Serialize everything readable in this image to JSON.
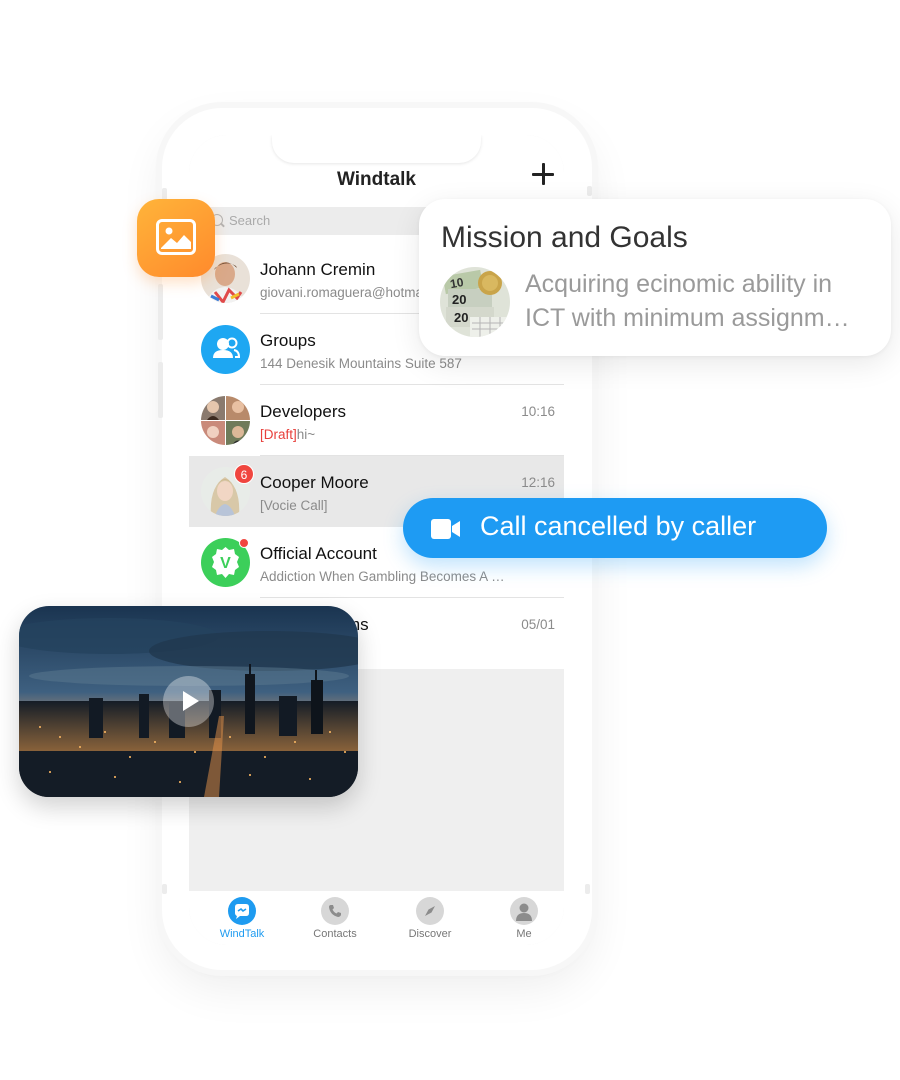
{
  "app": {
    "title": "Windtalk"
  },
  "search": {
    "placeholder": "Search"
  },
  "chats": [
    {
      "name": "Johann Cremin",
      "subtitle": "giovani.romaguera@hotmail.com",
      "time": ""
    },
    {
      "name": "Groups",
      "subtitle": "144 Denesik Mountains Suite 587",
      "time": ""
    },
    {
      "name": "Developers",
      "draft_label": "[Draft]",
      "subtitle": "hi~",
      "time": "10:16"
    },
    {
      "name": "Cooper Moore",
      "subtitle": "[Vocie Call]",
      "time": "12:16",
      "badge": "6"
    },
    {
      "name": "Official Account",
      "subtitle": "Addiction When Gambling Becomes A …",
      "time": ""
    },
    {
      "name": "…ms",
      "subtitle": "",
      "time": "05/01"
    }
  ],
  "tabs": [
    {
      "label": "WindTalk",
      "icon": "chat-bubble-icon",
      "active": true
    },
    {
      "label": "Contacts",
      "icon": "phone-icon",
      "active": false
    },
    {
      "label": "Discover",
      "icon": "compass-icon",
      "active": false
    },
    {
      "label": "Me",
      "icon": "person-icon",
      "active": false
    }
  ],
  "mission_card": {
    "title": "Mission and Goals",
    "line1": "Acquiring ecinomic ability in",
    "line2": "ICT with minimum assignm…"
  },
  "call_toast": {
    "text": "Call cancelled by caller"
  },
  "colors": {
    "accent": "#1e9bf3",
    "badge": "#f0463f",
    "gallery_orange": "#ff9a33",
    "official_green": "#3ccf5a"
  }
}
